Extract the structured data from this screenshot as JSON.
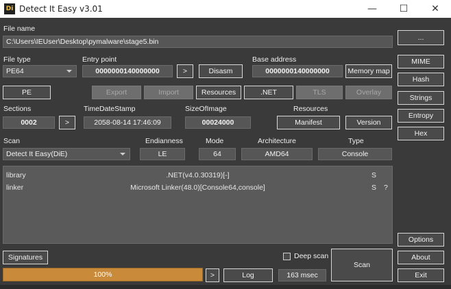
{
  "window": {
    "title": "Detect It Easy v3.01",
    "icon_text": "Di",
    "minimize": "—",
    "maximize": "☐",
    "close": "✕"
  },
  "file": {
    "label": "File name",
    "path": "C:\\Users\\IEUser\\Desktop\\pymalware\\stage5.bin",
    "browse": "..."
  },
  "filetype": {
    "label": "File type",
    "value": "PE64"
  },
  "entry_point": {
    "label": "Entry point",
    "value": "0000000140000000",
    "go": ">",
    "disasm": "Disasm"
  },
  "base_address": {
    "label": "Base address",
    "value": "0000000140000000",
    "memory_map": "Memory map"
  },
  "row_buttons": {
    "pe": "PE",
    "export": "Export",
    "import": "Import",
    "resources": "Resources",
    "net": ".NET",
    "tls": "TLS",
    "overlay": "Overlay"
  },
  "sections": {
    "label": "Sections",
    "value": "0002",
    "go": ">"
  },
  "timestamp": {
    "label": "TimeDateStamp",
    "value": "2058-08-14 17:46:09"
  },
  "size_of_image": {
    "label": "SizeOfImage",
    "value": "00024000"
  },
  "resources_group": {
    "label": "Resources",
    "manifest": "Manifest",
    "version": "Version"
  },
  "scan_info": {
    "scan_label": "Scan",
    "scan_value": "Detect It Easy(DiE)",
    "endianness_label": "Endianness",
    "endianness_value": "LE",
    "mode_label": "Mode",
    "mode_value": "64",
    "architecture_label": "Architecture",
    "architecture_value": "AMD64",
    "type_label": "Type",
    "type_value": "Console"
  },
  "results": [
    {
      "kind": "library",
      "name": ".NET(v4.0.30319)[-]",
      "flag": "S",
      "extra": ""
    },
    {
      "kind": "linker",
      "name": "Microsoft Linker(48.0)[Console64,console]",
      "flag": "S",
      "extra": "?"
    }
  ],
  "sidebar": {
    "mime": "MIME",
    "hash": "Hash",
    "strings": "Strings",
    "entropy": "Entropy",
    "hex": "Hex",
    "options": "Options",
    "about": "About",
    "exit": "Exit"
  },
  "bottom": {
    "signatures": "Signatures",
    "deep_scan": "Deep scan",
    "scan": "Scan",
    "progress_text": "100%",
    "progress_value": 100,
    "go": ">",
    "log": "Log",
    "elapsed": "163 msec"
  },
  "colors": {
    "background": "#3a3a3a",
    "progress": "#c98a3a",
    "field": "#565656"
  }
}
